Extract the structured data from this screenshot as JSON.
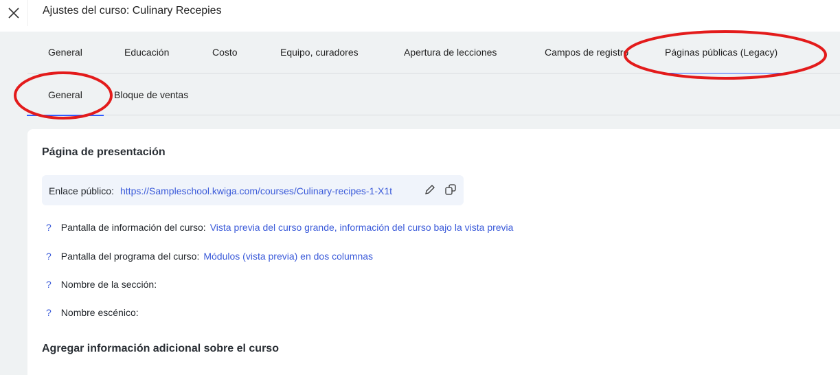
{
  "header": {
    "title": "Ajustes del curso: Culinary Recepies",
    "close_icon": "close-icon"
  },
  "tabs": [
    "General",
    "Educación",
    "Costo",
    "Equipo, curadores",
    "Apertura de lecciones",
    "Campos de registro",
    "Páginas públicas (Legacy)"
  ],
  "subtabs": [
    "General",
    "Bloque de ventas"
  ],
  "card": {
    "section_title": "Página de presentación",
    "link_label": "Enlace público:",
    "link_url": "https://Sampleschool.kwiga.com/courses/Culinary-recipes-1-X1t",
    "rows": [
      {
        "help": "?",
        "label": "Pantalla de información del curso:",
        "value": "Vista previa del curso grande, información del curso bajo la vista previa"
      },
      {
        "help": "?",
        "label": "Pantalla del programa del curso:",
        "value": "Módulos (vista previa) en dos columnas"
      },
      {
        "help": "?",
        "label": "Nombre de la sección:",
        "value": ""
      },
      {
        "help": "?",
        "label": "Nombre escénico:",
        "value": ""
      }
    ],
    "section2_title": "Agregar información adicional sobre el curso"
  },
  "colors": {
    "accent": "#3a5ad9",
    "annotation": "#e31b1b"
  }
}
